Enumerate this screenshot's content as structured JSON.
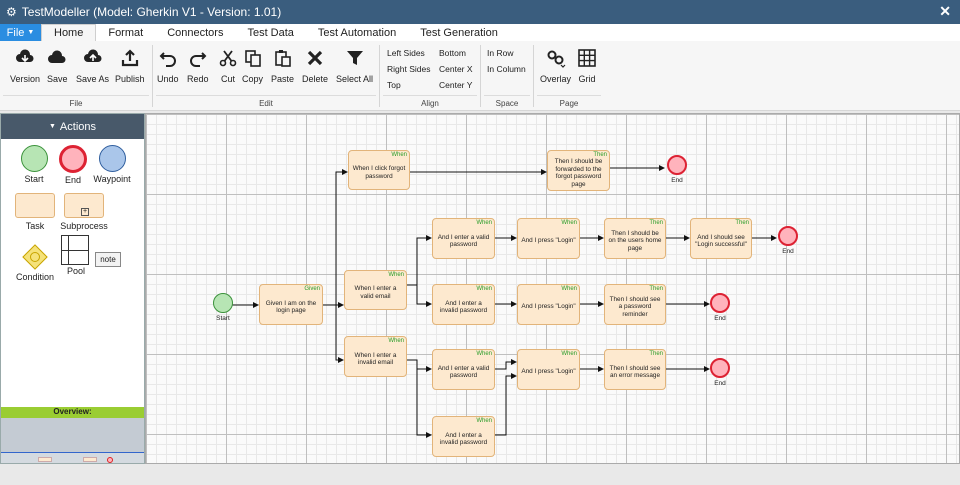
{
  "window": {
    "title": "TestModeller (Model: Gherkin V1 - Version: 1.01)"
  },
  "menu": {
    "file": "File",
    "tabs": [
      "Home",
      "Format",
      "Connectors",
      "Test Data",
      "Test Automation",
      "Test Generation"
    ],
    "active_tab": "Home"
  },
  "ribbon": {
    "file_group": {
      "label": "File",
      "buttons": [
        "Version",
        "Save",
        "Save As",
        "Publish"
      ]
    },
    "edit_group": {
      "label": "Edit",
      "buttons": [
        "Undo",
        "Redo",
        "Cut",
        "Copy",
        "Paste",
        "Delete",
        "Select All"
      ]
    },
    "align_group": {
      "label": "Align",
      "items": [
        "Left Sides",
        "Bottom",
        "Right Sides",
        "Center X",
        "Top",
        "Center Y"
      ]
    },
    "space_group": {
      "label": "Space",
      "items": [
        "In Row",
        "In Column"
      ]
    },
    "page_group": {
      "label": "Page",
      "buttons": [
        "Overlay",
        "Grid"
      ]
    }
  },
  "actions_panel": {
    "title": "Actions",
    "items": {
      "start": "Start",
      "end": "End",
      "waypoint": "Waypoint",
      "task": "Task",
      "subprocess": "Subprocess",
      "condition": "Condition",
      "pool": "Pool",
      "note": "note"
    },
    "overview": "Overview:"
  },
  "diagram": {
    "start_label": "Start",
    "end_label": "End",
    "nodes": [
      {
        "text": "Given I am on the login page",
        "keyword": "Given"
      },
      {
        "text": "When I click forgot password",
        "keyword": "When"
      },
      {
        "text": "When I enter a valid email",
        "keyword": "When"
      },
      {
        "text": "When I enter a invalid email",
        "keyword": "When"
      },
      {
        "text": "Then I should be forwarded to the forgot password page",
        "keyword": "Then"
      },
      {
        "text": "And I enter a valid password",
        "keyword": "When"
      },
      {
        "text": "And I enter a invalid password",
        "keyword": "When"
      },
      {
        "text": "And I enter a valid password",
        "keyword": "When"
      },
      {
        "text": "And I enter a invalid password",
        "keyword": "When"
      },
      {
        "text": "And I press \"Login\"",
        "keyword": "When"
      },
      {
        "text": "And I press \"Login\"",
        "keyword": "When"
      },
      {
        "text": "And I press \"Login\"",
        "keyword": "When"
      },
      {
        "text": "Then I should be on the users home page",
        "keyword": "Then"
      },
      {
        "text": "Then I should see a password reminder",
        "keyword": "Then"
      },
      {
        "text": "Then I should see an error message",
        "keyword": "Then"
      },
      {
        "text": "And I should see \"Login successful\"",
        "keyword": "Then"
      }
    ]
  },
  "colors": {
    "titlebar": "#3a5d7e",
    "file_button": "#2a8de1",
    "task_fill": "#fde9cf",
    "end_border": "#dd2233",
    "start_fill": "#b7e5b4",
    "keyword": "#2a9d2a",
    "overview_bar": "#9acd32"
  }
}
